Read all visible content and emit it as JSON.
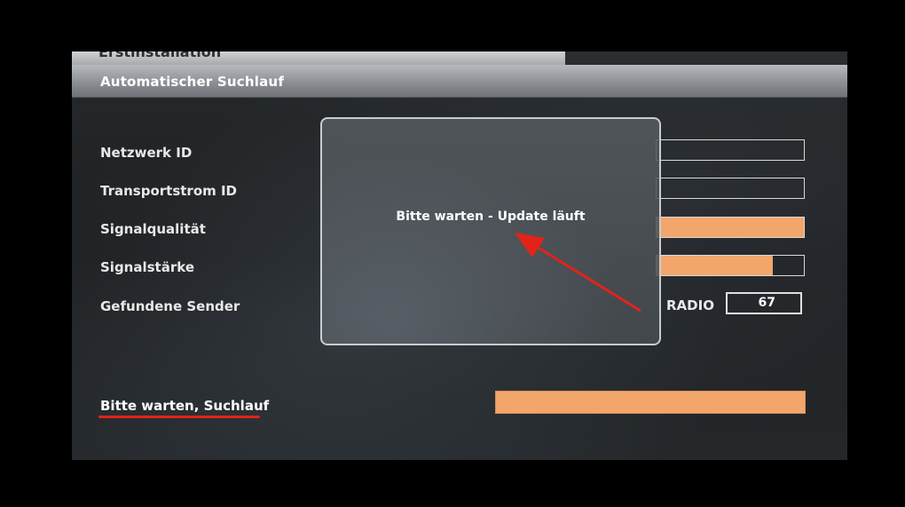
{
  "menu": {
    "prev_tab_title": "Erstinstallation",
    "title": "Automatischer Suchlauf"
  },
  "rows": [
    {
      "label": "Netzwerk ID"
    },
    {
      "label": "Transportstrom ID"
    },
    {
      "label": "Signalqualität",
      "level": 1.0
    },
    {
      "label": "Signalstärke",
      "level": 0.79
    },
    {
      "label": "Gefundene Sender"
    }
  ],
  "found_channels": {
    "radio_label": "RADIO",
    "radio_count": "67"
  },
  "status": {
    "label": "Bitte warten, Suchlauf",
    "progress": 1.0
  },
  "dialog": {
    "message": "Bitte warten - Update läuft"
  },
  "colors": {
    "bar_fill": "#f2a66b",
    "annotation_red": "#e2231a"
  }
}
